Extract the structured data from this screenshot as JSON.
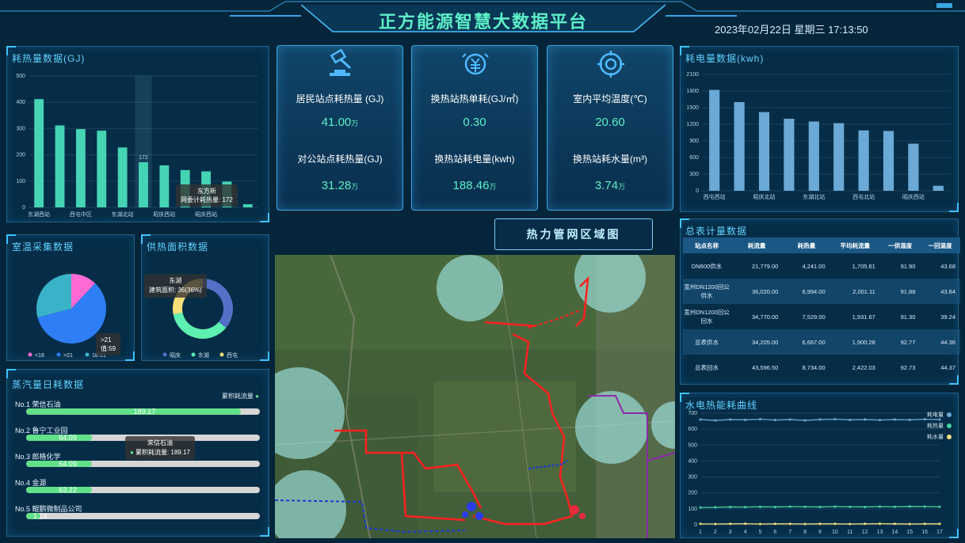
{
  "header": {
    "title": "正方能源智慧大数据平台",
    "datetime": "2023年02月22日   星期三   17:13:50"
  },
  "heat_consumption": {
    "title": "耗热量数据(GJ)",
    "chart_data": {
      "type": "bar",
      "ylim": [
        0,
        500
      ],
      "yticks": [
        "0",
        "100",
        "200",
        "300",
        "400",
        "500"
      ],
      "xtick_labels": [
        "东湖西站",
        "西屯中区",
        "东湖北站",
        "昭庆西站",
        "昭庆西站"
      ],
      "values": [
        412,
        312,
        298,
        292,
        228,
        172,
        160,
        142,
        137,
        98,
        12
      ],
      "highlight_value": "172",
      "tooltip_line1": "东方新",
      "tooltip_line2": "网委计耗热量: 172",
      "bar_color": "#45d4b4"
    }
  },
  "kpis": [
    {
      "label1": "居民站点耗热量 (GJ)",
      "value1": "41.00",
      "unit1": "万",
      "label2": "对公站点耗热量(GJ)",
      "value2": "31.28",
      "unit2": "万",
      "icon": "hammer-icon"
    },
    {
      "label1": "换热站热单耗(GJ/㎡)",
      "value1": "0.30",
      "unit1": "",
      "label2": "换热站耗电量(kwh)",
      "value2": "188.46",
      "unit2": "万",
      "icon": "money-icon"
    },
    {
      "label1": "室内平均温度(℃)",
      "value1": "20.60",
      "unit1": "",
      "label2": "换热站耗水量(m³)",
      "value2": "3.74",
      "unit2": "万",
      "icon": "target-icon"
    }
  ],
  "map": {
    "button_label": "热力管网区域图"
  },
  "indoor_temp": {
    "title": "室温采集数据",
    "chart_data": {
      "type": "pie",
      "slices": [
        {
          "name": "<18",
          "value": 12,
          "color": "#ff6ad5"
        },
        {
          "name": ">21",
          "value": 59,
          "color": "#2f7ef5"
        },
        {
          "name": "18-21",
          "value": 29,
          "color": "#3ab3c8"
        }
      ],
      "tooltip_line1": ">21",
      "tooltip_line2": "值:59"
    }
  },
  "heating_area": {
    "title": "供热面积数据",
    "chart_data": {
      "type": "pie",
      "slices": [
        {
          "name": "昭庆",
          "value": 36,
          "color": "#5470c6"
        },
        {
          "name": "东湖",
          "value": 36,
          "color": "#5ef0b0"
        },
        {
          "name": "西屯",
          "value": 28,
          "color": "#f5e07a"
        }
      ],
      "tooltip_line1": "东湖",
      "tooltip_line2": "建筑面积: 36(36%)"
    }
  },
  "steam": {
    "title": "蒸汽量日耗数据",
    "legend": "累积耗流量",
    "rows": [
      {
        "name": "No.1 荣信石油",
        "value": "189.17",
        "pct": 0.92
      },
      {
        "name": "No.2 鲁宁工业园",
        "value": "64.09",
        "pct": 0.28
      },
      {
        "name": "No.3 郎格化学",
        "value": "64.09",
        "pct": 0.28
      },
      {
        "name": "No.4 金源",
        "value": "63.22",
        "pct": 0.28
      },
      {
        "name": "No.5 鲲鹏微制品公司",
        "value": "1.14",
        "pct": 0.06
      }
    ],
    "tooltip_line1": "荣信石油",
    "tooltip_line2": "累积耗流量: 189.17"
  },
  "power": {
    "title": "耗电量数据(kwh)",
    "chart_data": {
      "type": "bar",
      "ylim": [
        0,
        2100
      ],
      "yticks": [
        "0",
        "300",
        "600",
        "900",
        "1200",
        "1500",
        "1800",
        "2100"
      ],
      "xtick_labels": [
        "西屯西站",
        "昭庆北站",
        "东湖北站",
        "西屯北站",
        "昭庆西站"
      ],
      "values": [
        1820,
        1600,
        1420,
        1300,
        1250,
        1220,
        1090,
        1080,
        850,
        90
      ],
      "bar_color": "#6ba9d6"
    }
  },
  "totals": {
    "title": "总表计量数据",
    "headers": [
      "站点名称",
      "耗流量",
      "耗热量",
      "平均耗流量",
      "一供温度",
      "一回温度"
    ],
    "rows": [
      [
        "DN600供水",
        "21,779.00",
        "4,241.00",
        "1,705.61",
        "91.90",
        "43.68"
      ],
      [
        "宽州DN1200回公供水",
        "36,020.00",
        "6,994.00",
        "2,001.11",
        "91.88",
        "43.84"
      ],
      [
        "宽州DN1200回公回水",
        "34,770.00",
        "7,529.00",
        "1,931.67",
        "91.30",
        "39.24"
      ],
      [
        "总表供水",
        "34,205.00",
        "6,667.00",
        "1,900.28",
        "92.77",
        "44.36"
      ],
      [
        "总表回水",
        "43,596.50",
        "8,734.00",
        "2,422.03",
        "92.73",
        "44.37"
      ]
    ]
  },
  "energy_curve": {
    "title": "水电热能耗曲线",
    "chart_data": {
      "type": "line",
      "x": [
        1,
        2,
        3,
        4,
        5,
        6,
        7,
        8,
        9,
        10,
        11,
        12,
        13,
        14,
        15,
        16,
        17
      ],
      "ylim": [
        0,
        700
      ],
      "yticks": [
        "0",
        "100",
        "200",
        "300",
        "400",
        "500",
        "600",
        "700"
      ],
      "series": [
        {
          "name": "耗电量",
          "color": "#6ba9d6",
          "values": [
            660,
            655,
            660,
            658,
            662,
            657,
            660,
            655,
            660,
            662,
            658,
            660,
            657,
            660,
            658,
            662,
            660
          ]
        },
        {
          "name": "耗热量",
          "color": "#45d4a0",
          "values": [
            108,
            110,
            112,
            111,
            113,
            112,
            114,
            113,
            112,
            114,
            113,
            112,
            114,
            113,
            115,
            114,
            113
          ]
        },
        {
          "name": "耗水量",
          "color": "#f5e07a",
          "values": [
            6,
            5,
            6,
            7,
            5,
            6,
            6,
            5,
            6,
            6,
            5,
            6,
            7,
            6,
            5,
            6,
            6
          ]
        }
      ]
    }
  }
}
